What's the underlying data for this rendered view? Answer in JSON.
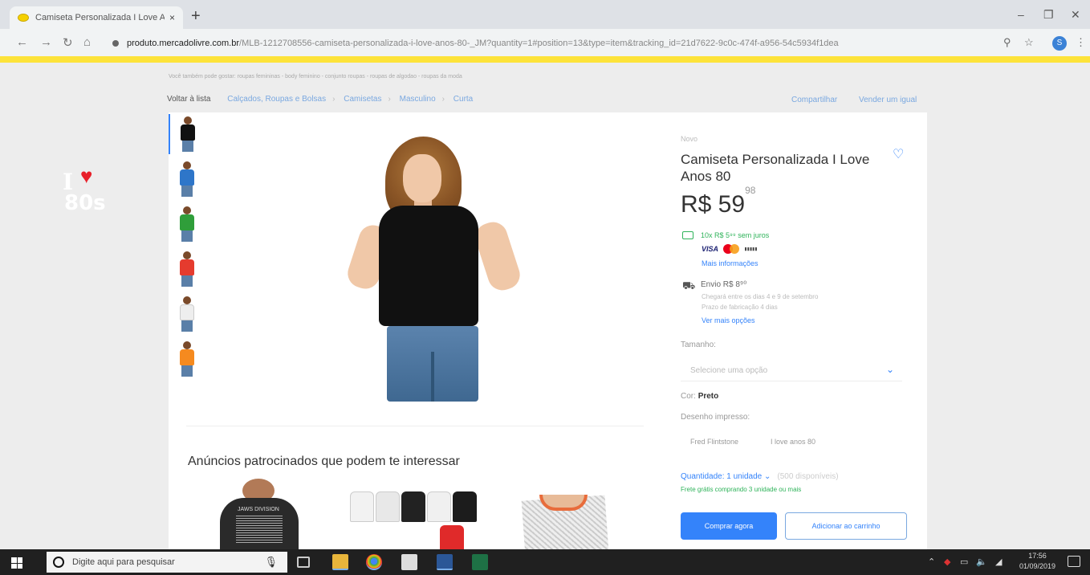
{
  "browser": {
    "tab_title": "Camiseta Personalizada I Love A...",
    "url_host": "produto.mercadolivre.com.br",
    "url_path": "/MLB-1212708556-camiseta-personalizada-i-love-anos-80-_JM?quantity=1#position=13&type=item&tracking_id=21d7622-9c0c-474f-a956-54c5934f1dea",
    "profile_initial": "S"
  },
  "page": {
    "top_breadcrumbs": "Você também pode gostar: roupas femininas - body feminino - conjunto roupas - roupas de algodao - roupas da moda",
    "back_link": "Voltar à lista",
    "breadcrumb": [
      "Calçados, Roupas e Bolsas",
      "Camisetas",
      "Masculino",
      "Curta"
    ],
    "share": "Compartilhar",
    "sell_same": "Vender um igual"
  },
  "product": {
    "condition": "Novo",
    "title": "Camiseta Personalizada I Love Anos 80",
    "price_main": "R$ 59",
    "price_cents": "98",
    "shirt_text_i": "I",
    "shirt_text_80": "80s",
    "installments": "10x R$ 5⁹⁹ sem juros",
    "card_visa": "VISA",
    "card_boleto": "▮▮▮▮▮",
    "more_info": "Mais informações",
    "shipping": "Envio R$ 8⁹⁰",
    "shipping_eta": "Chegará entre os dias 4 e 9 de setembro",
    "shipping_prod": "Prazo de fabricação 4 dias",
    "more_options": "Ver mais opções",
    "size_label": "Tamanho:",
    "size_placeholder": "Selecione uma opção",
    "color_label": "Cor:",
    "color_value": "Preto",
    "design_label": "Desenho impresso:",
    "design_options": [
      "Fred Flintstone",
      "I love anos 80"
    ],
    "qty_label": "Quantidade: 1 unidade",
    "qty_available": "(500 disponíveis)",
    "free_shipping": "Frete grátis comprando 3 unidade ou mais",
    "buy_now": "Comprar agora",
    "add_to_cart": "Adicionar ao carrinho"
  },
  "sponsored": {
    "heading": "Anúncios patrocinados que podem te interessar",
    "ad1_text": "JAWS DIVISION"
  },
  "taskbar": {
    "search_placeholder": "Digite aqui para pesquisar",
    "time": "17:56",
    "date": "01/09/2019"
  },
  "colors": {
    "accent": "#3483fa",
    "brand_yellow": "#fde33a",
    "success": "#2fb35a"
  }
}
